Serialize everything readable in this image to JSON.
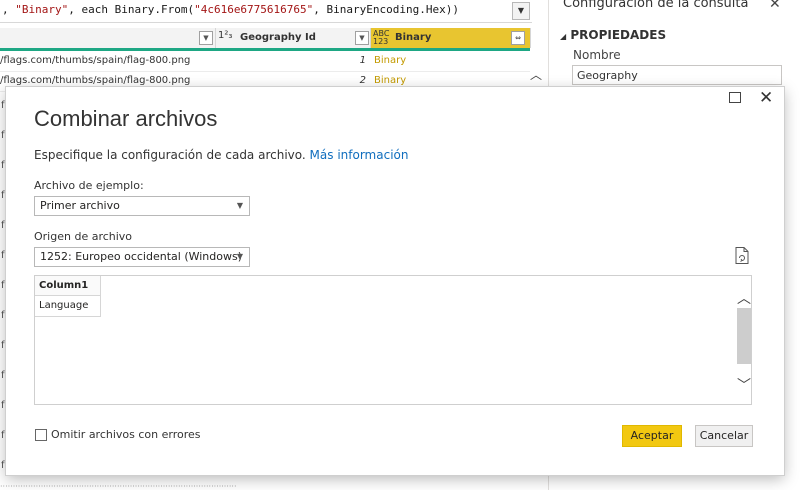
{
  "formula": {
    "prefix": ", ",
    "str1": "\"Binary\"",
    "mid": ", each Binary.From(",
    "str2": "\"4c616e6775616765\"",
    "suffix": ", BinaryEncoding.Hex))"
  },
  "grid": {
    "columns": [
      {
        "type": "",
        "label": ""
      },
      {
        "type": "1²₃",
        "label": "Geography Id"
      },
      {
        "type": "ABC 123",
        "label": "Binary"
      }
    ],
    "rows": [
      {
        "url": "/flags.com/thumbs/spain/flag-800.png",
        "id": "1",
        "binary": "Binary"
      },
      {
        "url": "/flags.com/thumbs/spain/flag-800.png",
        "id": "2",
        "binary": "Binary"
      }
    ]
  },
  "query_settings": {
    "title": "Configuración de la consulta",
    "section": "PROPIEDADES",
    "name_label": "Nombre",
    "name_value": "Geography"
  },
  "dialog": {
    "title": "Combinar archivos",
    "description": "Especifique la configuración de cada archivo.",
    "more_info": "Más información",
    "sample_label": "Archivo de ejemplo:",
    "sample_value": "Primer archivo",
    "origin_label": "Origen de archivo",
    "origin_value": "1252: Europeo occidental (Windows)",
    "preview": {
      "header": "Column1",
      "rows": [
        "Language"
      ]
    },
    "skip_errors_label": "Omitir archivos con errores",
    "ok_label": "Aceptar",
    "cancel_label": "Cancelar"
  },
  "colors": {
    "accent_yellow": "#f2c811",
    "link_blue": "#106ebe",
    "header_teal": "#1ea784"
  }
}
